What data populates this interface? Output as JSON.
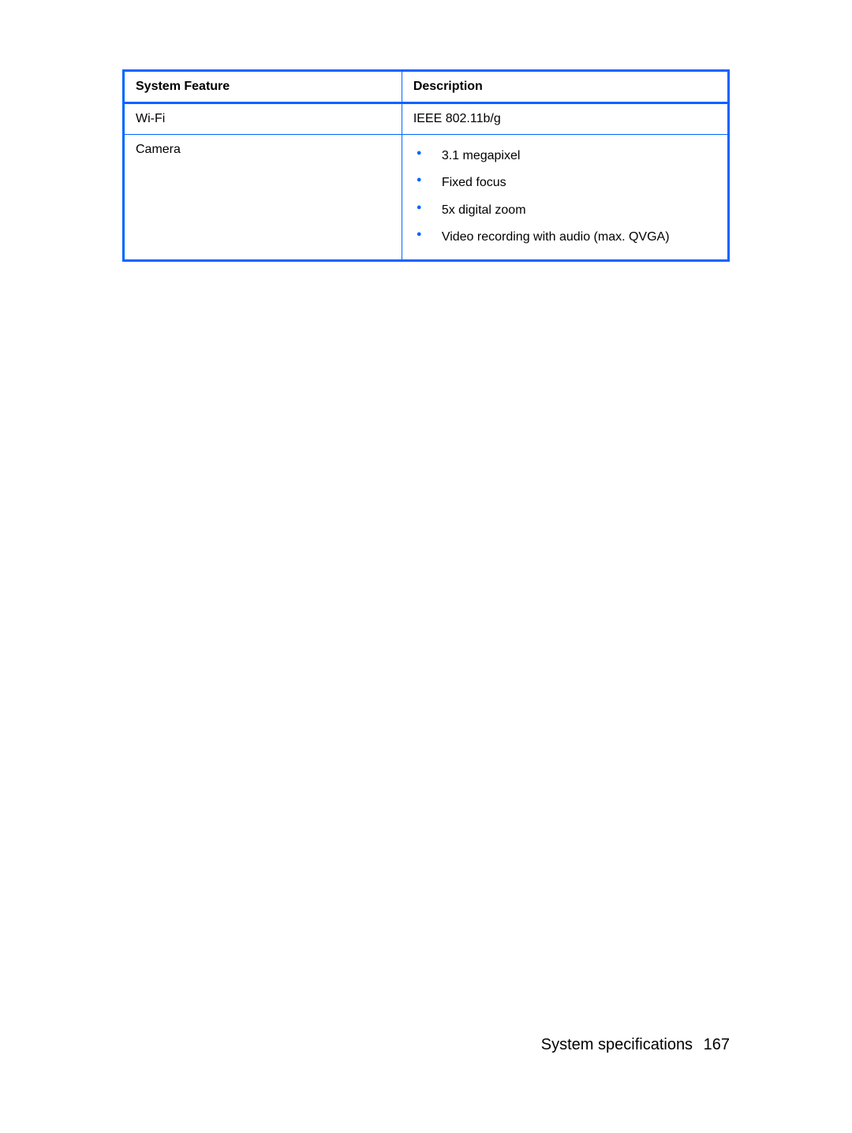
{
  "table": {
    "headers": {
      "feature": "System Feature",
      "description": "Description"
    },
    "rows": [
      {
        "feature": "Wi-Fi",
        "description_text": "IEEE 802.11b/g"
      },
      {
        "feature": "Camera",
        "description_list": [
          "3.1 megapixel",
          "Fixed focus",
          "5x digital zoom",
          "Video recording with audio (max. QVGA)"
        ]
      }
    ]
  },
  "footer": {
    "section": "System specifications",
    "page_number": "167"
  }
}
